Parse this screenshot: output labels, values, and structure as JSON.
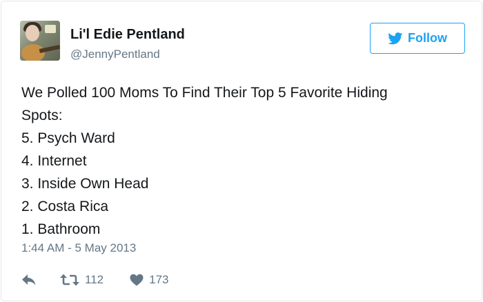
{
  "user": {
    "display_name": "Li'l Edie Pentland",
    "handle": "@JennyPentland"
  },
  "follow_button": {
    "label": "Follow"
  },
  "tweet": {
    "lines": [
      "We Polled 100 Moms To Find Their Top 5 Favorite Hiding",
      "Spots:",
      "5. Psych Ward",
      "4. Internet",
      "3. Inside Own Head",
      "2. Costa Rica",
      "1. Bathroom"
    ],
    "timestamp": "1:44 AM - 5 May 2013"
  },
  "actions": {
    "retweet_count": "112",
    "like_count": "173"
  },
  "icons": {
    "reply": "reply-icon",
    "retweet": "retweet-icon",
    "like": "heart-icon",
    "follow": "twitter-bird-icon"
  },
  "colors": {
    "accent": "#1da1f2",
    "text": "#14171a",
    "muted": "#657786",
    "border": "#e1e8ed"
  }
}
